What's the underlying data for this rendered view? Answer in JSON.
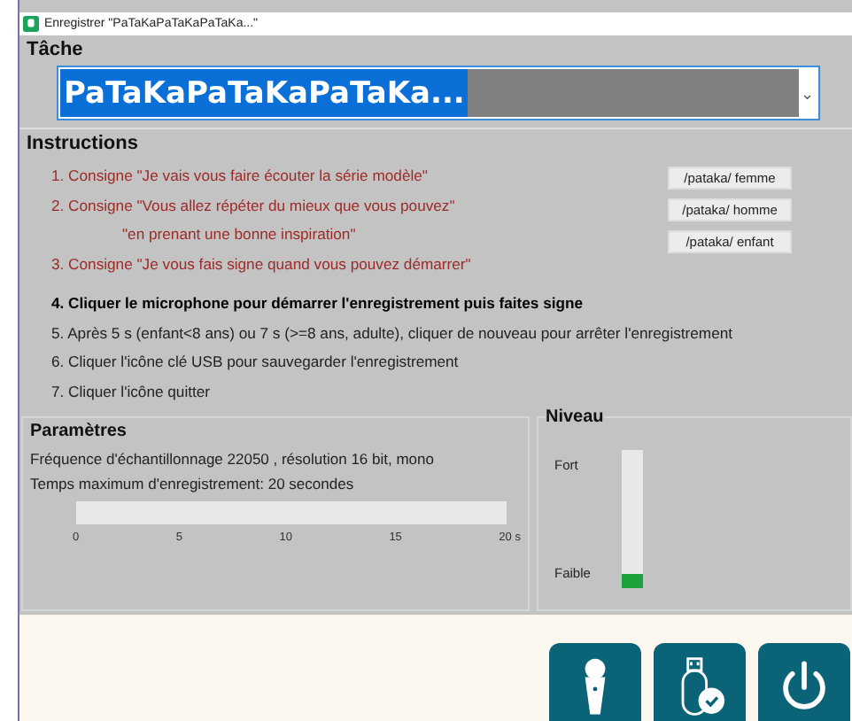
{
  "window": {
    "title": "Enregistrer \"PaTaKaPaTaKaPaTaKa...\""
  },
  "task": {
    "label": "Tâche",
    "value": "PaTaKaPaTaKaPaTaKa...",
    "dropdown": "⌄"
  },
  "instructions": {
    "label": "Instructions",
    "lines": [
      {
        "kind": "consigne",
        "text": "1. Consigne \"Je vais vous faire écouter la série modèle\""
      },
      {
        "kind": "consigne",
        "text": "2. Consigne \"Vous allez répéter du mieux que vous pouvez\""
      },
      {
        "kind": "continuation",
        "text": "\"en prenant une bonne inspiration\""
      },
      {
        "kind": "consigne",
        "text": "3. Consigne \"Je vous fais signe quand vous pouvez démarrer\""
      },
      {
        "kind": "bold",
        "text": "4. Cliquer le microphone pour démarrer l'enregistrement puis faites signe"
      },
      {
        "kind": "normal",
        "text": "5. Après 5 s (enfant<8 ans) ou 7 s (>=8 ans, adulte), cliquer de nouveau pour arrêter l'enregistrement"
      },
      {
        "kind": "normal",
        "text": "6. Cliquer l'icône clé USB pour sauvegarder l'enregistrement"
      },
      {
        "kind": "normal",
        "text": "7. Cliquer l'icône quitter"
      }
    ],
    "buttons": [
      "/pataka/ femme",
      "/pataka/ homme",
      "/pataka/ enfant"
    ]
  },
  "parameters": {
    "label": "Paramètres",
    "lines": [
      "Fréquence d'échantillonnage 22050 , résolution 16 bit, mono",
      "Temps maximum d'enregistrement: 20 secondes"
    ],
    "progress": {
      "level": 0,
      "ticks": [
        "0",
        "5",
        "10",
        "15",
        "20 s"
      ]
    }
  },
  "level_meter": {
    "label": "Niveau",
    "high": "Fort",
    "low": "Faible",
    "level": 0.1
  },
  "toolbar": [
    {
      "kind": "microphone"
    },
    {
      "kind": "usb"
    },
    {
      "kind": "power"
    }
  ]
}
